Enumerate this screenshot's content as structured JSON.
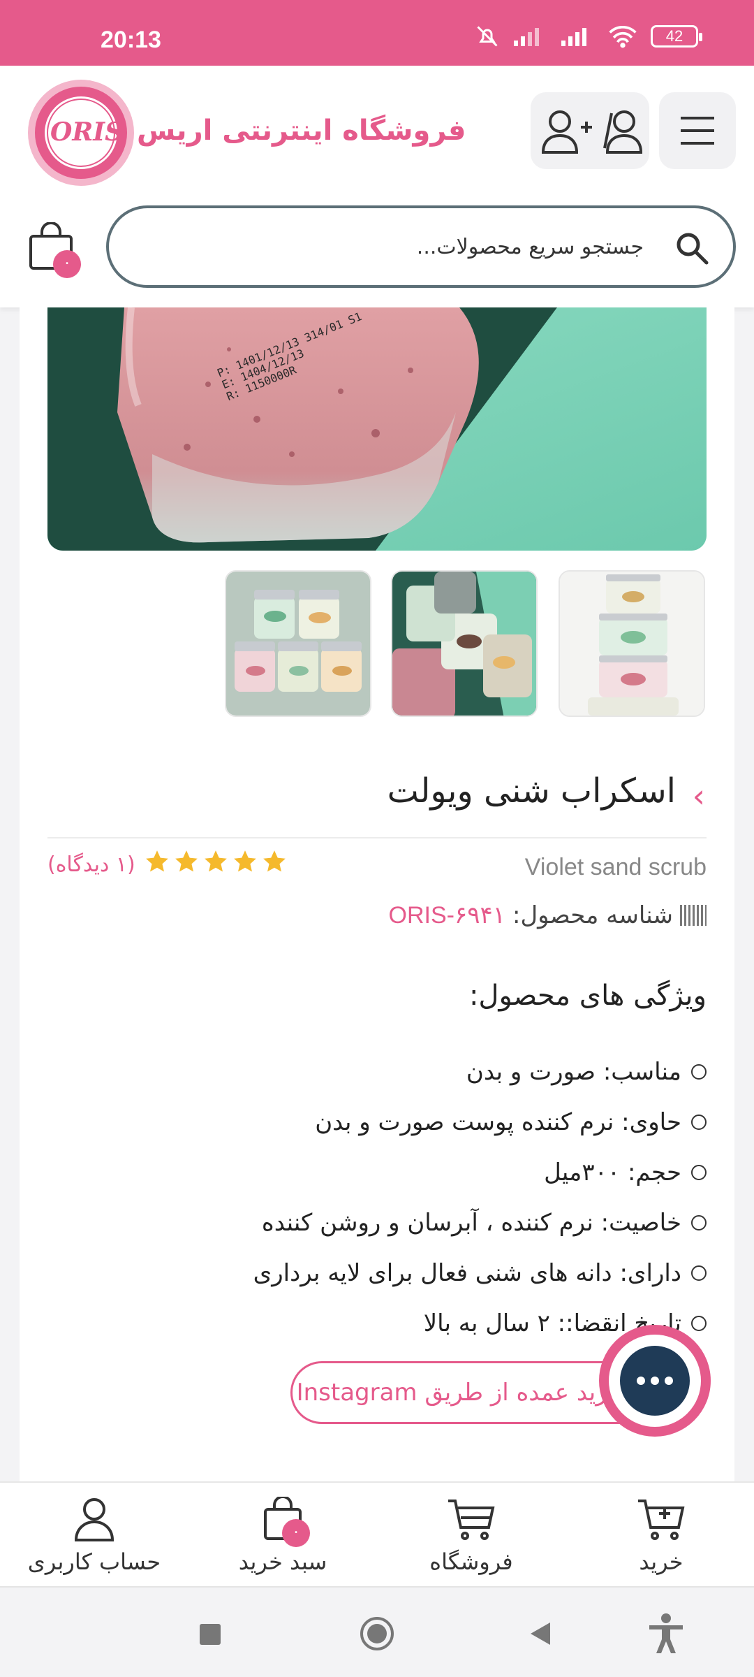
{
  "status_bar": {
    "time": "20:13",
    "battery": "42"
  },
  "header": {
    "brand_logo_text": "ORIS",
    "brand_name": "فروشگاه اینترنتی اریس",
    "search_placeholder": "جستجو سریع محصولات...",
    "cart_count": "۰"
  },
  "product": {
    "title": "اسکراب شنی ویولت",
    "english_name": "Violet sand scrub",
    "rating_stars": 5,
    "reviews": "(۱ دیدگاه)",
    "sku_label": "شناسه محصول:",
    "sku_value": "ORIS-۶۹۴۱",
    "image_print": [
      "P: 1401/12/13  314/01 S1",
      "E: 1404/12/13",
      "R: 1150000R"
    ],
    "features_title": "ویژگی های محصول:",
    "features": [
      "مناسب: صورت و بدن",
      "حاوی: نرم کننده پوست صورت و بدن",
      "حجم: ۳۰۰میل",
      "خاصیت: نرم کننده ، آبرسان و روشن کننده",
      "دارای: دانه های شنی فعال برای لایه برداری",
      "تاریخ انقضا:: ۲ سال به بالا"
    ],
    "instagram_button": "خرید عمده از طریق Instagram"
  },
  "bottom_nav": {
    "buy": "خرید",
    "shop": "فروشگاه",
    "cart": "سبد خرید",
    "cart_count": "۰",
    "account": "حساب کاربری"
  },
  "colors": {
    "accent": "#e55a8b",
    "dark": "#1f3b57"
  }
}
